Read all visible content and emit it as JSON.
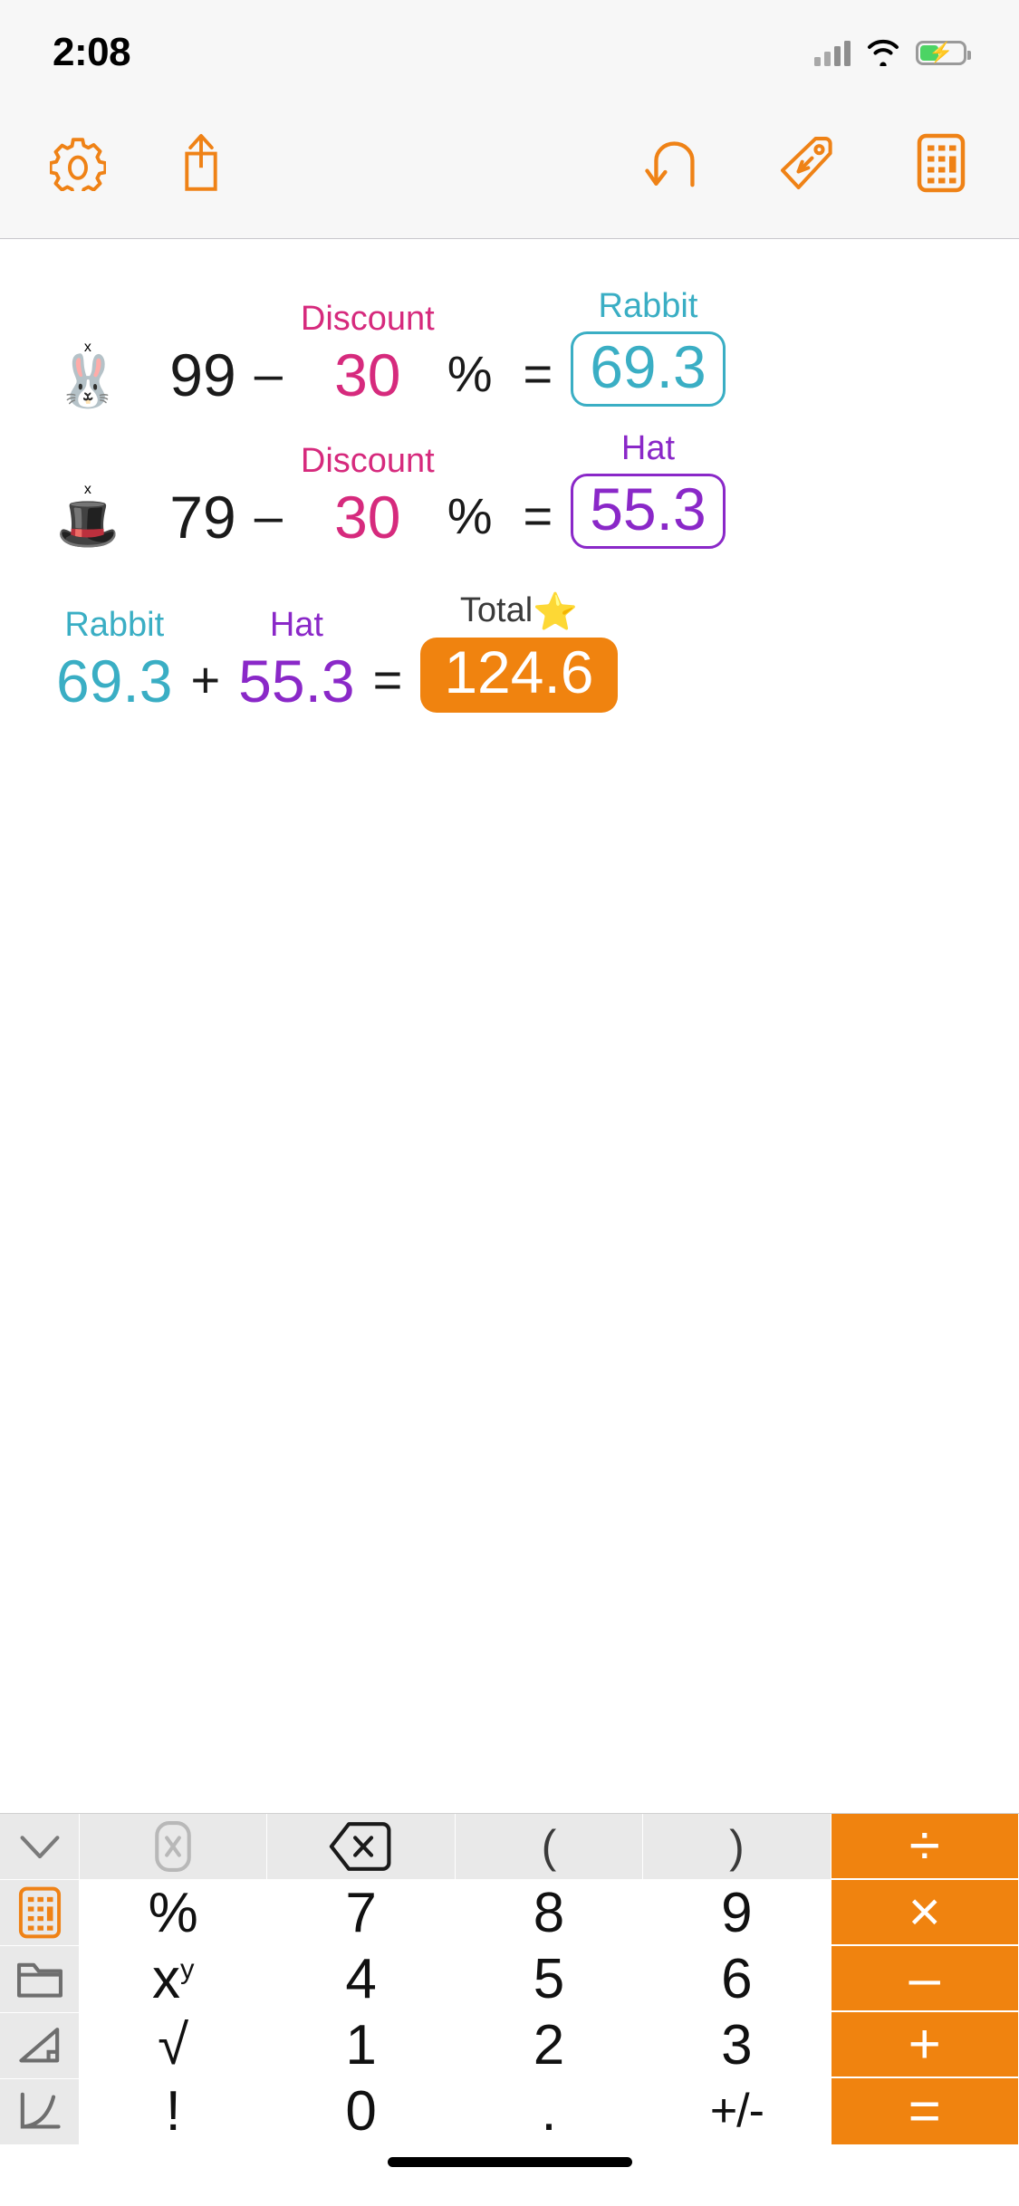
{
  "status_bar": {
    "time": "2:08",
    "signal_icon": "cellular-signal-icon",
    "wifi_icon": "wifi-icon",
    "battery_icon": "battery-charging-icon"
  },
  "toolbar": {
    "left_buttons": [
      {
        "name": "settings-button",
        "icon": "gear-icon"
      },
      {
        "name": "share-button",
        "icon": "share-up-arrow-icon"
      }
    ],
    "right_buttons": [
      {
        "name": "undo-button",
        "icon": "undo-arrow-icon"
      },
      {
        "name": "label-button",
        "icon": "tag-icon"
      },
      {
        "name": "keypad-toggle-button",
        "icon": "calculator-icon"
      }
    ]
  },
  "colors": {
    "accent_orange": "#f0830f",
    "pink": "#d62a7d",
    "teal": "#3aaec4",
    "purple": "#8a28c8",
    "black": "#1a1a1a"
  },
  "tape": {
    "rows": [
      {
        "name": "calc-row-rabbit",
        "emoji": "🐰",
        "emoji_name": "rabbit-face-emoji",
        "operand1": "99",
        "operator1": "–",
        "operand2_label": "Discount",
        "operand2": "30",
        "operator2": "%",
        "equals": "=",
        "result_label": "Rabbit",
        "result": "69.3",
        "result_style": "outlined",
        "result_color": "#3aaec4",
        "label_color": "#d62a7d"
      },
      {
        "name": "calc-row-hat",
        "emoji": "🎩",
        "emoji_name": "top-hat-emoji",
        "operand1": "79",
        "operator1": "–",
        "operand2_label": "Discount",
        "operand2": "30",
        "operator2": "%",
        "equals": "=",
        "result_label": "Hat",
        "result": "55.3",
        "result_style": "outlined",
        "result_color": "#8a28c8",
        "label_color": "#d62a7d"
      }
    ],
    "total_row": {
      "name": "calc-row-total",
      "operand1_label": "Rabbit",
      "operand1": "69.3",
      "operand1_color": "#3aaec4",
      "operator": "+",
      "operand2_label": "Hat",
      "operand2": "55.3",
      "operand2_color": "#8a28c8",
      "equals": "=",
      "result_label": "Total",
      "result_label_emoji": "⭐",
      "result": "124.6",
      "result_style": "filled",
      "result_color": "#f0830f"
    }
  },
  "keypad": {
    "side_column": [
      {
        "name": "side-key-calculator",
        "icon": "calculator-icon",
        "active": true
      },
      {
        "name": "side-key-folder",
        "icon": "folder-icon",
        "active": false
      },
      {
        "name": "side-key-geometry",
        "icon": "right-triangle-icon",
        "active": false
      },
      {
        "name": "side-key-graph",
        "icon": "graph-curve-icon",
        "active": false
      }
    ],
    "rows": [
      [
        {
          "name": "collapse-keypad-key",
          "label": "",
          "icon": "chevron-down-icon",
          "style": "grey"
        },
        {
          "name": "clear-key",
          "label": "",
          "icon": "clear-all-icon",
          "style": "grey-muted"
        },
        {
          "name": "backspace-key",
          "label": "",
          "icon": "backspace-icon",
          "style": "grey"
        },
        {
          "name": "open-paren-key",
          "label": "(",
          "style": "grey"
        },
        {
          "name": "close-paren-key",
          "label": ")",
          "style": "grey"
        },
        {
          "name": "divide-key",
          "label": "÷",
          "style": "orange"
        }
      ],
      [
        {
          "name": "percent-key",
          "label": "%",
          "style": "white"
        },
        {
          "name": "digit-7-key",
          "label": "7",
          "style": "white"
        },
        {
          "name": "digit-8-key",
          "label": "8",
          "style": "white"
        },
        {
          "name": "digit-9-key",
          "label": "9",
          "style": "white"
        },
        {
          "name": "multiply-key",
          "label": "×",
          "style": "orange"
        }
      ],
      [
        {
          "name": "power-key",
          "label": "xy",
          "style": "white"
        },
        {
          "name": "digit-4-key",
          "label": "4",
          "style": "white"
        },
        {
          "name": "digit-5-key",
          "label": "5",
          "style": "white"
        },
        {
          "name": "digit-6-key",
          "label": "6",
          "style": "white"
        },
        {
          "name": "subtract-key",
          "label": "–",
          "style": "orange"
        }
      ],
      [
        {
          "name": "sqrt-key",
          "label": "√",
          "style": "white"
        },
        {
          "name": "digit-1-key",
          "label": "1",
          "style": "white"
        },
        {
          "name": "digit-2-key",
          "label": "2",
          "style": "white"
        },
        {
          "name": "digit-3-key",
          "label": "3",
          "style": "white"
        },
        {
          "name": "add-key",
          "label": "+",
          "style": "orange"
        }
      ],
      [
        {
          "name": "factorial-key",
          "label": "!",
          "style": "white"
        },
        {
          "name": "digit-0-key",
          "label": "0",
          "style": "white"
        },
        {
          "name": "decimal-point-key",
          "label": ".",
          "style": "white"
        },
        {
          "name": "sign-toggle-key",
          "label": "+/-",
          "style": "white"
        },
        {
          "name": "equals-key",
          "label": "=",
          "style": "orange"
        }
      ]
    ]
  },
  "home_indicator": {
    "name": "home-indicator"
  }
}
